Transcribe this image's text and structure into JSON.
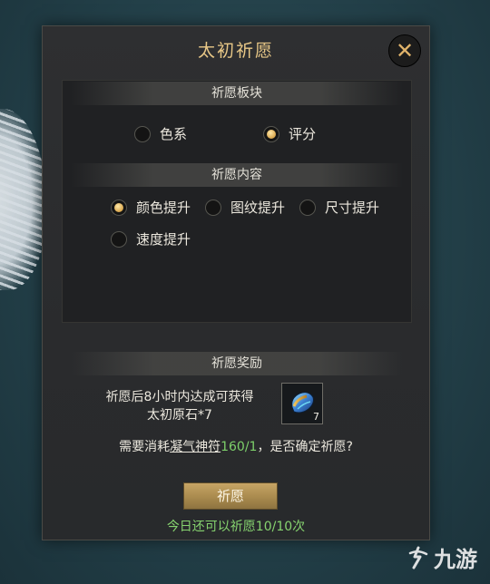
{
  "dialog": {
    "title": "太初祈愿",
    "close_icon": "close-icon"
  },
  "wish_block": {
    "header": "祈愿板块",
    "options": [
      {
        "label": "色系",
        "selected": false
      },
      {
        "label": "评分",
        "selected": true
      }
    ]
  },
  "wish_content": {
    "header": "祈愿内容",
    "options": [
      {
        "label": "颜色提升",
        "selected": true
      },
      {
        "label": "图纹提升",
        "selected": false
      },
      {
        "label": "尺寸提升",
        "selected": false
      },
      {
        "label": "速度提升",
        "selected": false
      }
    ]
  },
  "reward": {
    "header": "祈愿奖励",
    "line1": "祈愿后8小时内达成可获得",
    "line2": "太初原石*7",
    "item_icon": "gem-icon",
    "item_count": "7"
  },
  "confirm": {
    "prefix": "需要消耗",
    "item_name": "凝气神符",
    "amount": "160/1",
    "suffix": "，是否确定祈愿?"
  },
  "wish_button": "祈愿",
  "remaining_text": "今日还可以祈愿10/10次",
  "watermark": "九游",
  "colors": {
    "title": "#e9c887",
    "green": "#7dd06a",
    "button": "#b3935a"
  }
}
